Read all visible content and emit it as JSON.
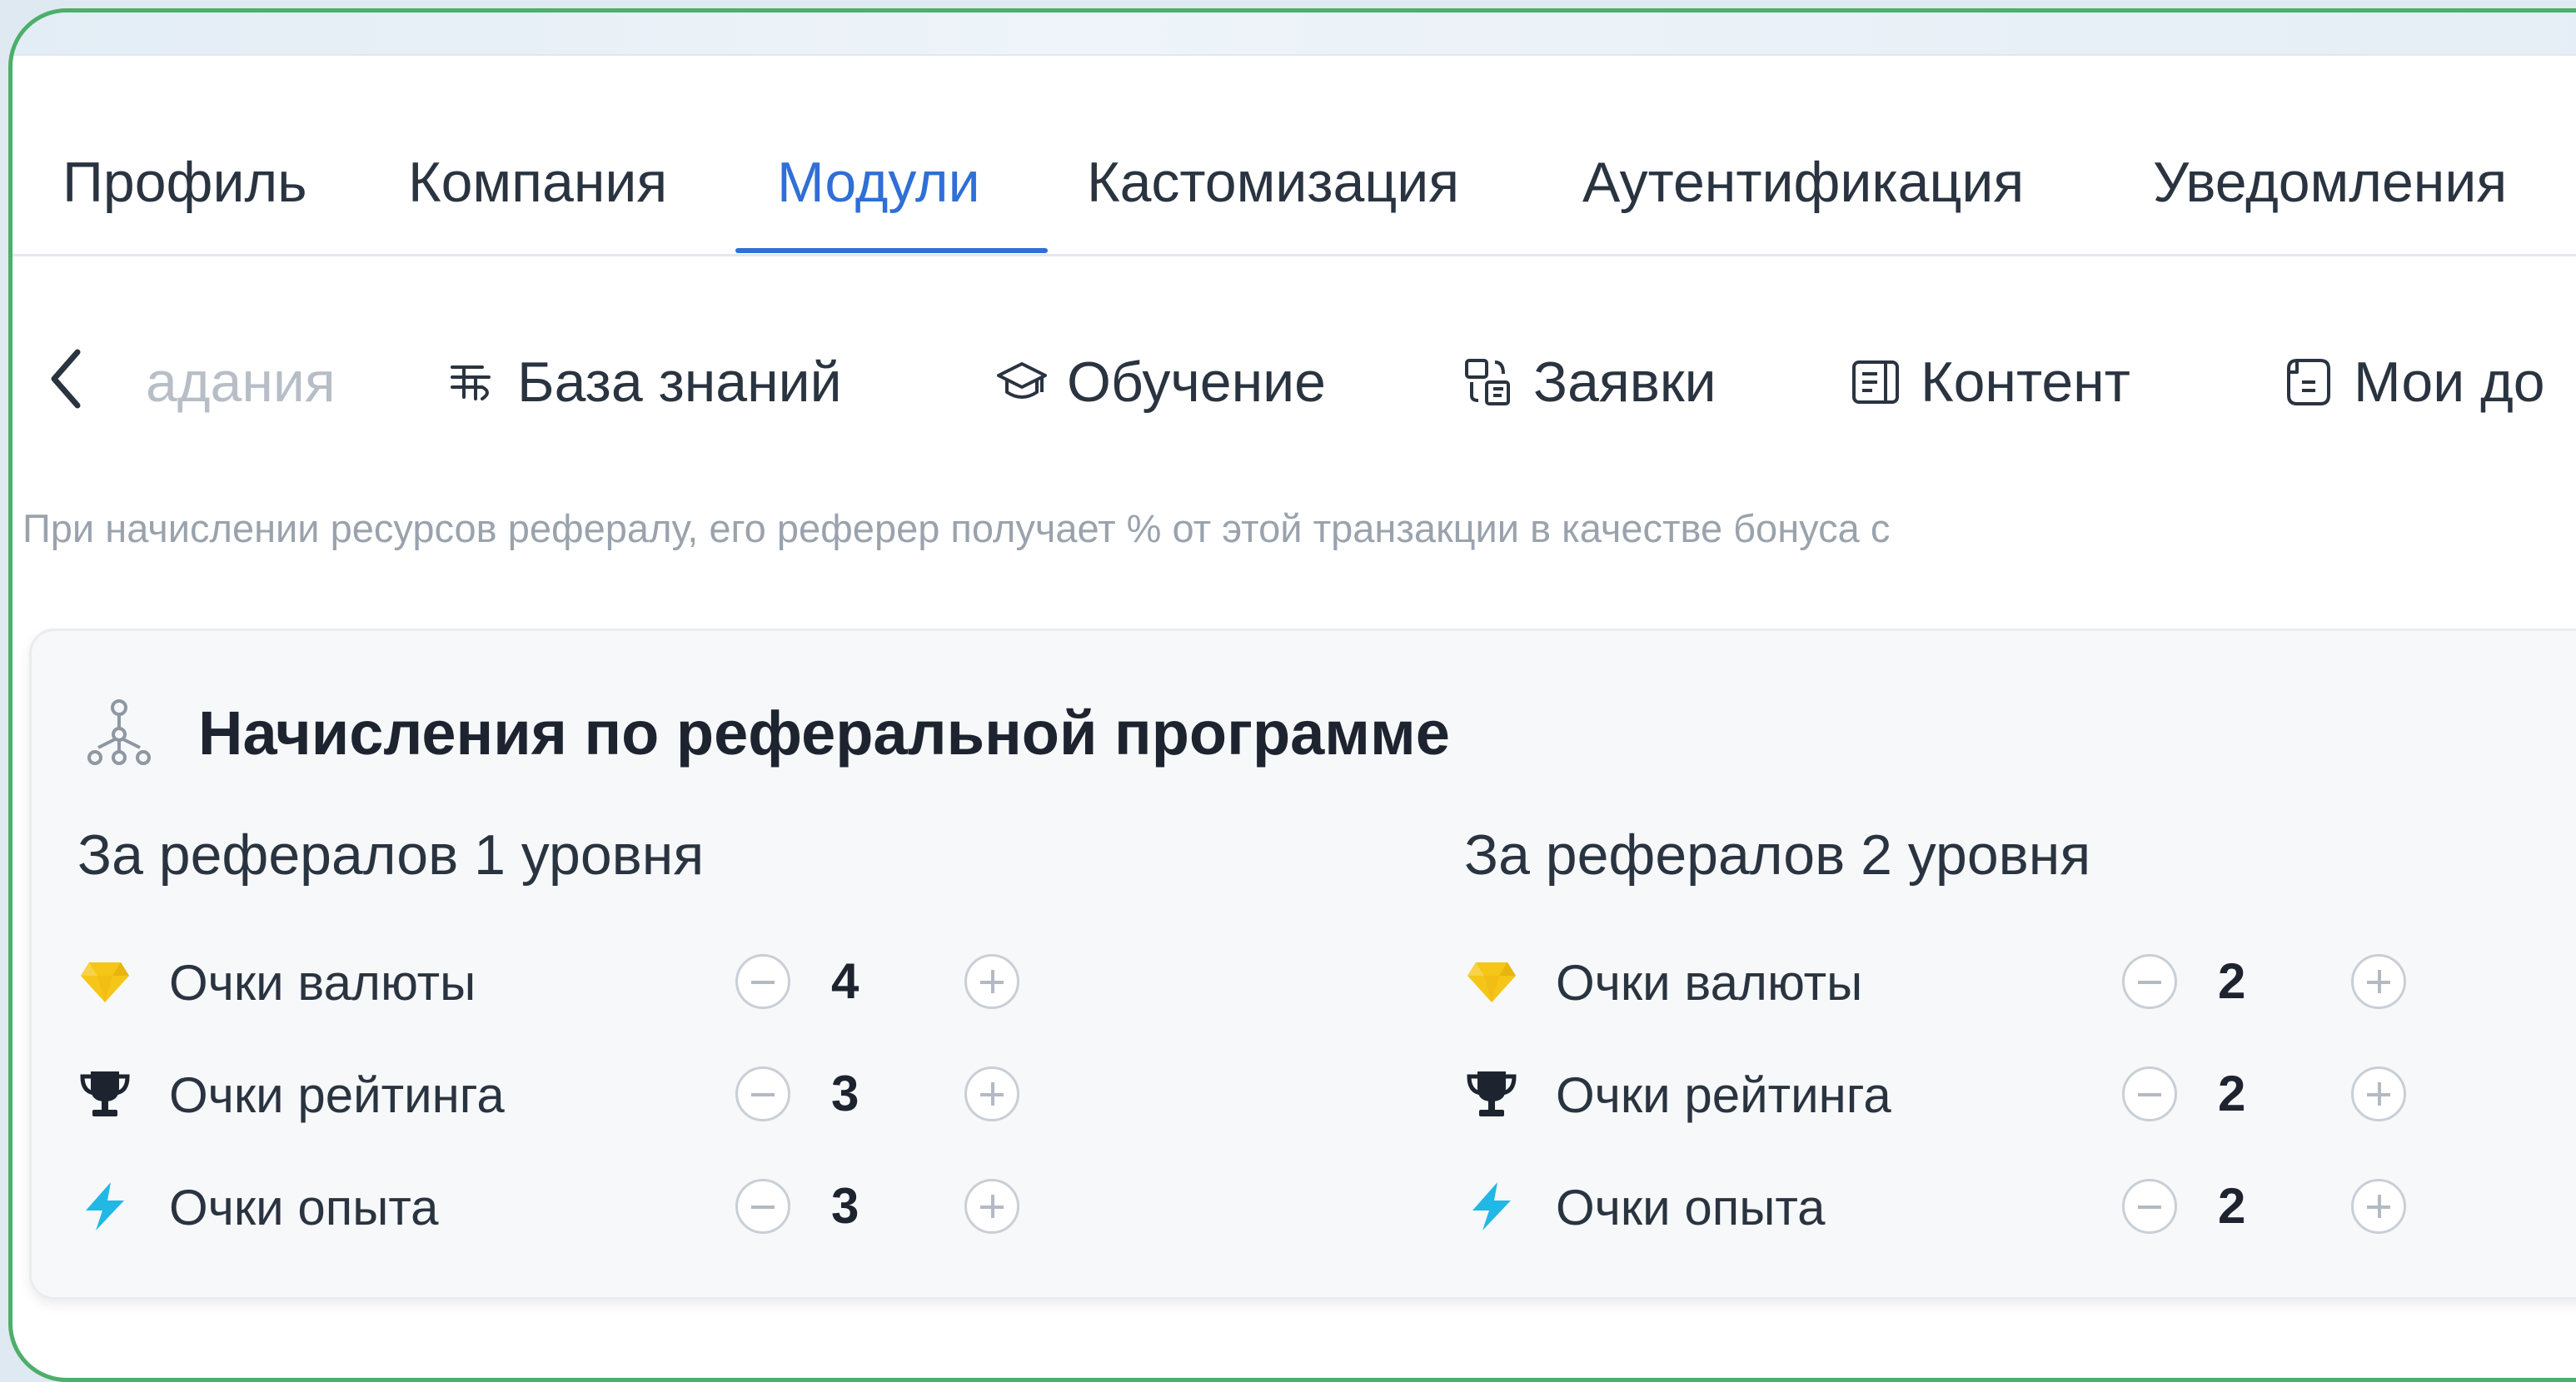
{
  "tabs": [
    {
      "label": "Профиль"
    },
    {
      "label": "Компания"
    },
    {
      "label": "Модули",
      "active": true
    },
    {
      "label": "Кастомизация"
    },
    {
      "label": "Аутентификация"
    },
    {
      "label": "Уведомления"
    }
  ],
  "module_nav": {
    "items": [
      {
        "label": "адания",
        "icon": "none"
      },
      {
        "label": "База знаний",
        "icon": "knowledge-base-icon"
      },
      {
        "label": "Обучение",
        "icon": "graduation-cap-icon"
      },
      {
        "label": "Заявки",
        "icon": "requests-icon"
      },
      {
        "label": "Контент",
        "icon": "content-icon"
      },
      {
        "label": "Мои до",
        "icon": "document-icon"
      }
    ]
  },
  "hint": "При начислении ресурсов рефералу, его реферер получает % от этой транзакции в качестве бонуса с",
  "card": {
    "title": "Начисления по реферальной программе",
    "icon": "referral-tree-icon",
    "columns": [
      {
        "heading": "За рефералов 1 уровня",
        "rows": [
          {
            "label": "Очки валюты",
            "icon": "diamond-icon",
            "value": "4"
          },
          {
            "label": "Очки рейтинга",
            "icon": "trophy-icon",
            "value": "3"
          },
          {
            "label": "Очки опыта",
            "icon": "lightning-icon",
            "value": "3"
          }
        ]
      },
      {
        "heading": "За рефералов 2 уровня",
        "rows": [
          {
            "label": "Очки валюты",
            "icon": "diamond-icon",
            "value": "2"
          },
          {
            "label": "Очки рейтинга",
            "icon": "trophy-icon",
            "value": "2"
          },
          {
            "label": "Очки опыта",
            "icon": "lightning-icon",
            "value": "2"
          }
        ]
      }
    ]
  },
  "colors": {
    "accent": "#2f6fd6",
    "frame": "#4caf6a",
    "diamond": "#f5c518",
    "trophy": "#1d2430",
    "lightning": "#22b8e6"
  }
}
